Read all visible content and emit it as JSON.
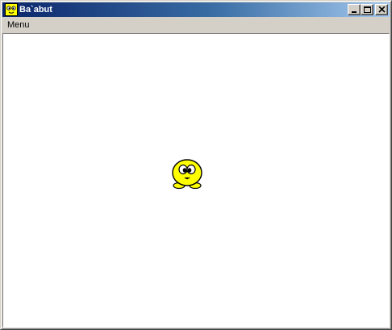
{
  "window": {
    "title": "Ba`abut",
    "icon": "creature-app-icon"
  },
  "title_buttons": {
    "minimize_icon": "minimize-icon",
    "maximize_icon": "maximize-icon",
    "close_icon": "close-icon"
  },
  "menubar": {
    "items": [
      {
        "label": "Menu"
      }
    ]
  },
  "canvas": {
    "background": "#ffffff",
    "creature": {
      "icon": "yellow-creature",
      "color": "#ffff00"
    }
  },
  "colors": {
    "titlebar_start": "#0a246a",
    "titlebar_end": "#a6caf0",
    "chrome": "#d4d0c8"
  }
}
